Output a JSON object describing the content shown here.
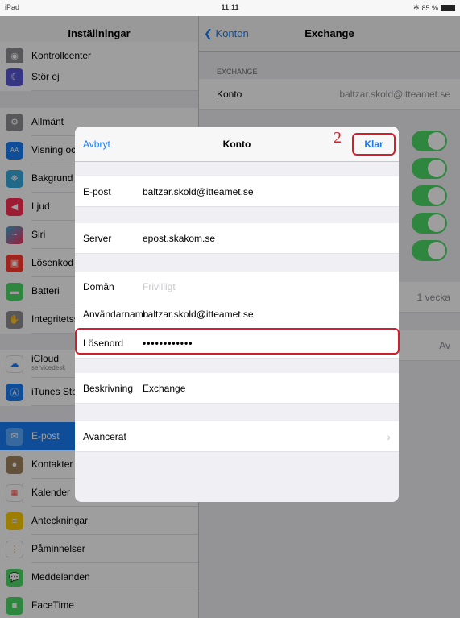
{
  "statusbar": {
    "device": "iPad",
    "wifi": "wifi-icon",
    "time": "11:11",
    "bt": "✻",
    "battery": "85 %"
  },
  "sidebar": {
    "title": "Inställningar",
    "items": [
      {
        "label": "Kontrollcenter",
        "icon": "control-center-icon",
        "color": "#8e8e93"
      },
      {
        "label": "Stör ej",
        "icon": "moon-icon",
        "color": "#5856d6"
      },
      {
        "label": "Allmänt",
        "icon": "gear-icon",
        "color": "#8e8e93"
      },
      {
        "label": "Visning och ljusstyrka",
        "icon": "display-icon",
        "color": "#1a7cf5"
      },
      {
        "label": "Bakgrund",
        "icon": "wallpaper-icon",
        "color": "#34aadc"
      },
      {
        "label": "Ljud",
        "icon": "speaker-icon",
        "color": "#ff2d55"
      },
      {
        "label": "Siri",
        "icon": "siri-icon",
        "color": "#333"
      },
      {
        "label": "Lösenkod",
        "icon": "lock-icon",
        "color": "#ff3b30"
      },
      {
        "label": "Batteri",
        "icon": "battery-icon",
        "color": "#4cd964"
      },
      {
        "label": "Integritetsskydd",
        "icon": "hand-icon",
        "color": "#8e8e93"
      },
      {
        "label": "iCloud",
        "sub": "servicedesk",
        "icon": "cloud-icon",
        "color": "#ffffff"
      },
      {
        "label": "iTunes Store och App Store",
        "icon": "app-store-icon",
        "color": "#1a7cf5"
      },
      {
        "label": "E-post",
        "icon": "mail-icon",
        "color": "#1a7cf5"
      },
      {
        "label": "Kontakter",
        "icon": "contacts-icon",
        "color": "#a2845e"
      },
      {
        "label": "Kalender",
        "icon": "calendar-icon",
        "color": "#ffffff"
      },
      {
        "label": "Anteckningar",
        "icon": "notes-icon",
        "color": "#ffcc00"
      },
      {
        "label": "Påminnelser",
        "icon": "reminders-icon",
        "color": "#ffffff"
      },
      {
        "label": "Meddelanden",
        "icon": "messages-icon",
        "color": "#4cd964"
      },
      {
        "label": "FaceTime",
        "icon": "facetime-icon",
        "color": "#4cd964"
      }
    ]
  },
  "detail": {
    "back": "Konton",
    "title": "Exchange",
    "section": "EXCHANGE",
    "account_label": "Konto",
    "account_value": "baltzar.skold@itteamet.se",
    "sync_value": "1 vecka",
    "autoreply_value": "Av"
  },
  "modal": {
    "cancel": "Avbryt",
    "title": "Konto",
    "done": "Klar",
    "step": "2",
    "email_label": "E-post",
    "email_value": "baltzar.skold@itteamet.se",
    "server_label": "Server",
    "server_value": "epost.skakom.se",
    "domain_label": "Domän",
    "domain_placeholder": "Frivilligt",
    "username_label": "Användarnamn",
    "username_value": "baltzar.skold@itteamet.se",
    "password_label": "Lösenord",
    "password_value": "••••••••••••",
    "description_label": "Beskrivning",
    "description_value": "Exchange",
    "advanced_label": "Avancerat"
  },
  "colors": {
    "accent": "#1a7cf5",
    "annotation": "#d0202e",
    "toggle_on": "#4cd964"
  }
}
